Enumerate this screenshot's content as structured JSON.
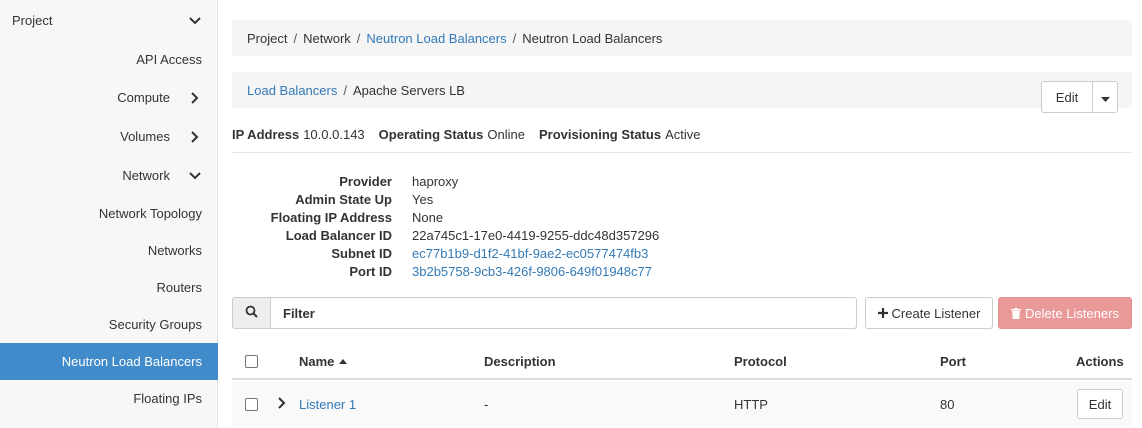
{
  "sidebar": {
    "items": [
      {
        "label": "Project",
        "kind": "top",
        "icon": "chevron-down-icon"
      },
      {
        "label": "API Access",
        "kind": "sub"
      },
      {
        "label": "Compute",
        "kind": "group",
        "icon": "chevron-right-icon"
      },
      {
        "label": "Volumes",
        "kind": "group",
        "icon": "chevron-right-icon"
      },
      {
        "label": "Network",
        "kind": "group",
        "icon": "chevron-down-icon"
      },
      {
        "label": "Network Topology",
        "kind": "sub"
      },
      {
        "label": "Networks",
        "kind": "sub"
      },
      {
        "label": "Routers",
        "kind": "sub"
      },
      {
        "label": "Security Groups",
        "kind": "sub"
      },
      {
        "label": "Neutron Load Balancers",
        "kind": "sub",
        "active": true
      },
      {
        "label": "Floating IPs",
        "kind": "sub"
      }
    ]
  },
  "breadcrumb": {
    "items": [
      "Project",
      "Network",
      "Neutron Load Balancers",
      "Neutron Load Balancers"
    ],
    "separator": "/"
  },
  "detail_crumb": {
    "parent": "Load Balancers",
    "current": "Apache Servers LB"
  },
  "actions": {
    "edit_label": "Edit"
  },
  "status": {
    "ip_label": "IP Address",
    "ip_value": "10.0.0.143",
    "op_label": "Operating Status",
    "op_value": "Online",
    "prov_label": "Provisioning Status",
    "prov_value": "Active"
  },
  "details": [
    {
      "key": "Provider",
      "value": "haproxy",
      "link": false
    },
    {
      "key": "Admin State Up",
      "value": "Yes",
      "link": false
    },
    {
      "key": "Floating IP Address",
      "value": "None",
      "link": false
    },
    {
      "key": "Load Balancer ID",
      "value": "22a745c1-17e0-4419-9255-ddc48d357296",
      "link": false
    },
    {
      "key": "Subnet ID",
      "value": "ec77b1b9-d1f2-41bf-9ae2-ec0577474fb3",
      "link": true
    },
    {
      "key": "Port ID",
      "value": "3b2b5758-9cb3-426f-9806-649f01948c77",
      "link": true
    }
  ],
  "filter": {
    "placeholder": "Filter",
    "create_label": "Create Listener",
    "delete_label": "Delete Listeners"
  },
  "table": {
    "columns": {
      "name": "Name",
      "description": "Description",
      "protocol": "Protocol",
      "port": "Port",
      "actions": "Actions"
    },
    "rows": [
      {
        "name": "Listener 1",
        "description": "-",
        "protocol": "HTTP",
        "port": "80",
        "action": "Edit"
      }
    ]
  },
  "colors": {
    "link": "#337ab7",
    "active_nav": "#428bca",
    "danger_disabled": "#e99a98"
  }
}
